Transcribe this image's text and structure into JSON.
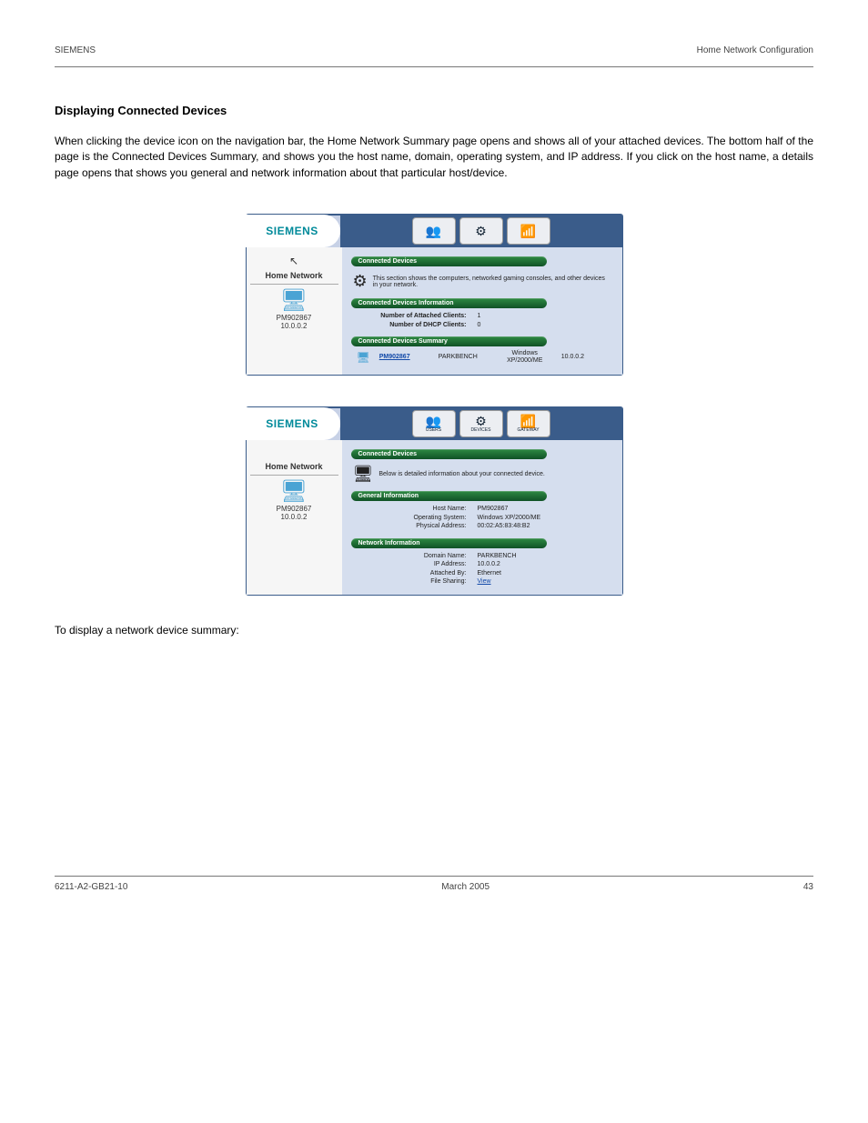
{
  "header": {
    "left": "SIEMENS",
    "right": "Home Network Configuration"
  },
  "section_title": "Displaying Connected Devices",
  "intro_text": "When clicking the device icon on the navigation bar, the Home Network Summary page opens and shows all of your attached devices. The bottom half of the page is the Connected Devices Summary, and shows you the host name, domain, operating system, and IP address. If you click on the host name, a details page opens that shows you general and network information about that particular host/device.",
  "logo_text": "SIEMENS",
  "sidebar": {
    "title": "Home Network",
    "device_name": "PM902867",
    "device_ip": "10.0.0.2"
  },
  "tabs": {
    "users": "USERS",
    "devices": "DEVICES",
    "gateway": "GATEWAY"
  },
  "screenshot1": {
    "pill1": "Connected Devices",
    "description": "This section shows the computers, networked gaming consoles, and other devices in your network.",
    "pill2": "Connected Devices Information",
    "info_rows": [
      {
        "label": "Number of Attached Clients:",
        "value": "1"
      },
      {
        "label": "Number of DHCP Clients:",
        "value": "0"
      }
    ],
    "pill3": "Connected Devices Summary",
    "summary": {
      "name": "PM902867",
      "domain": "PARKBENCH",
      "os": "Windows XP/2000/ME",
      "ip": "10.0.0.2"
    }
  },
  "screenshot2": {
    "pill1": "Connected Devices",
    "description": "Below is detailed information about your connected device.",
    "pill2": "General Information",
    "general_rows": [
      {
        "label": "Host Name:",
        "value": "PM902867"
      },
      {
        "label": "Operating System:",
        "value": "Windows XP/2000/ME"
      },
      {
        "label": "Physical Address:",
        "value": "00:02:A5:83:48:B2"
      }
    ],
    "pill3": "Network Information",
    "network_rows": [
      {
        "label": "Domain Name:",
        "value": "PARKBENCH"
      },
      {
        "label": "IP Address:",
        "value": "10.0.0.2"
      },
      {
        "label": "Attached By:",
        "value": "Ethernet"
      },
      {
        "label": "File Sharing:",
        "value": "View",
        "link": true
      }
    ]
  },
  "below_text": "To display a network device summary:",
  "footer": {
    "left": "6211-A2-GB21-10",
    "center": "March 2005",
    "right": "43"
  }
}
